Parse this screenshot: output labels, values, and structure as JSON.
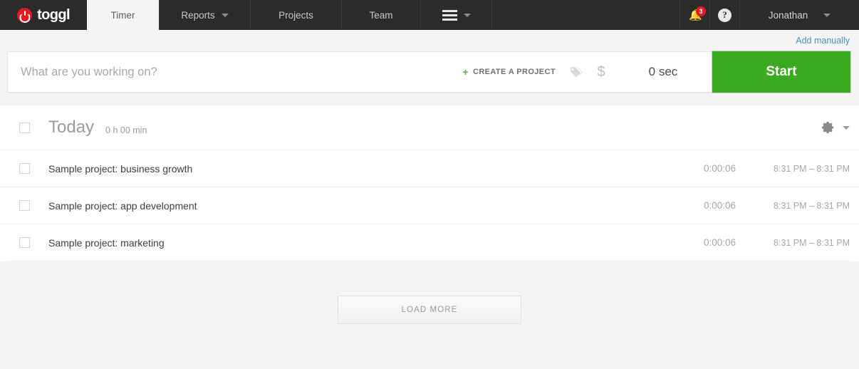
{
  "app": {
    "logo_text": "toggl",
    "logo_icon": "power-icon"
  },
  "nav": {
    "tabs": [
      {
        "label": "Timer",
        "icon": null,
        "active": true
      },
      {
        "label": "Reports",
        "icon": "chevron-down-icon",
        "active": false
      },
      {
        "label": "Projects",
        "icon": null,
        "active": false
      },
      {
        "label": "Team",
        "icon": null,
        "active": false
      },
      {
        "label": "",
        "icon": "hamburger-icon",
        "active": false
      }
    ],
    "notifications": {
      "icon": "bell-icon",
      "count": "3"
    },
    "help": {
      "icon": "help-icon",
      "glyph": "?"
    },
    "user": {
      "name": "Jonathan",
      "icon": "chevron-down-icon"
    }
  },
  "timer": {
    "add_manually_label": "Add manually",
    "input_value": "",
    "input_placeholder": "What are you working on?",
    "create_project_label": "CREATE A PROJECT",
    "create_project_plus": "+",
    "tag_icon": "tag-icon",
    "billable_icon": "dollar-icon",
    "billable_glyph": "$",
    "duration": "0 sec",
    "start_label": "Start",
    "accent_green": "#3aaa20",
    "link_blue": "#4a8fc0"
  },
  "day_group": {
    "title": "Today",
    "total": "0 h 00 min",
    "settings_icon": "gear-icon",
    "settings_caret": "chevron-down-icon"
  },
  "entries": [
    {
      "title": "Sample project: business growth",
      "duration": "0:00:06",
      "times": "8:31 PM – 8:31 PM"
    },
    {
      "title": "Sample project: app development",
      "duration": "0:00:06",
      "times": "8:31 PM – 8:31 PM"
    },
    {
      "title": "Sample project: marketing",
      "duration": "0:00:06",
      "times": "8:31 PM – 8:31 PM"
    }
  ],
  "footer": {
    "load_more_label": "LOAD MORE"
  }
}
